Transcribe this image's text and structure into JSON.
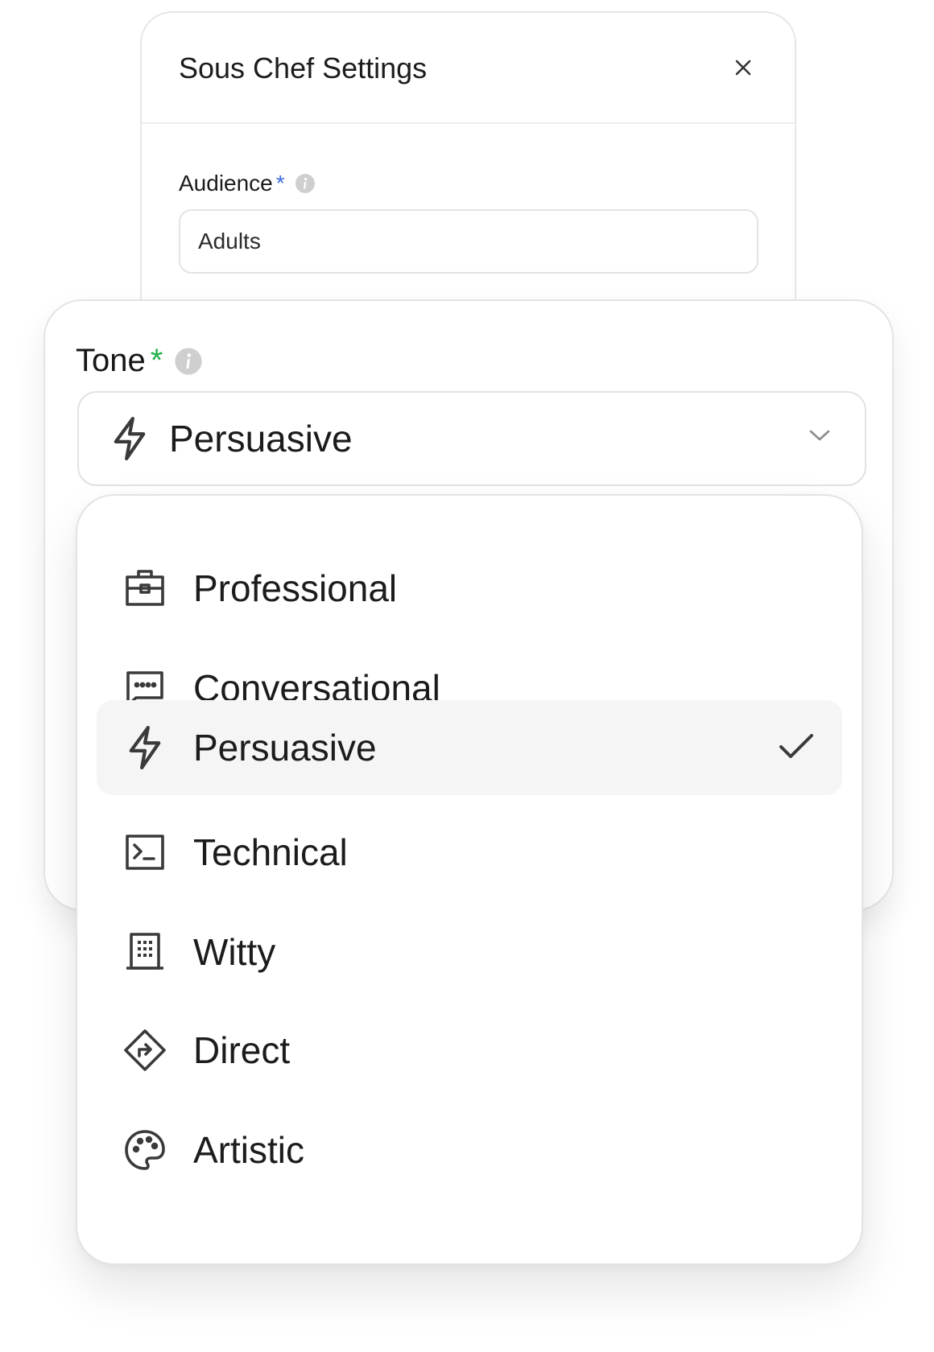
{
  "settings": {
    "title": "Sous Chef Settings",
    "close_icon": "close-icon",
    "audience": {
      "label": "Audience",
      "required_mark": "*",
      "value": "Adults"
    }
  },
  "tone": {
    "label": "Tone",
    "required_mark": "*",
    "selected_value": "Persuasive",
    "selected_icon": "lightning-icon",
    "options": [
      {
        "label": "Professional",
        "icon": "briefcase-icon",
        "selected": false
      },
      {
        "label": "Conversational",
        "icon": "chat-dots-icon",
        "selected": false
      },
      {
        "label": "Persuasive",
        "icon": "lightning-icon",
        "selected": true
      },
      {
        "label": "Technical",
        "icon": "terminal-icon",
        "selected": false
      },
      {
        "label": "Witty",
        "icon": "building-icon",
        "selected": false
      },
      {
        "label": "Direct",
        "icon": "direction-sign-icon",
        "selected": false
      },
      {
        "label": "Artistic",
        "icon": "palette-icon",
        "selected": false
      }
    ]
  },
  "colors": {
    "required_blue": "#3b6be0",
    "required_green": "#22b14c",
    "selected_bg": "#f5f5f5"
  }
}
